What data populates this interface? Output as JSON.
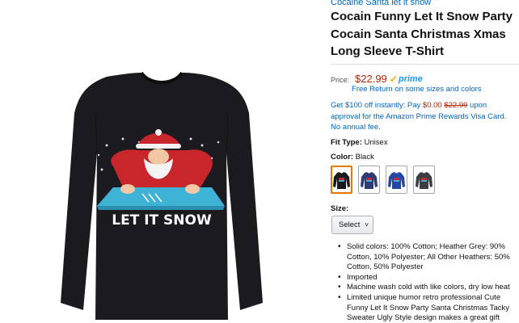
{
  "product": {
    "brand_link": "Cocaine Santa let it snow",
    "title": "Cocain Funny Let It Snow Party Cocain Santa Christmas Xmas Long Sleeve T-Shirt",
    "image_caption": "LET IT SNOW"
  },
  "pricing": {
    "label": "Price:",
    "price": "$22.99",
    "prime_label": "prime",
    "free_return": "Free Return on some sizes and colors",
    "promo_prefix": "Get $100 off instantly: Pay ",
    "promo_pay": "$0.00",
    "promo_strike": "$22.99",
    "promo_suffix": " upon approval for the Amazon Prime Rewards Visa Card. No annual fee."
  },
  "fit": {
    "label": "Fit Type:",
    "value": "Unisex"
  },
  "color": {
    "label": "Color:",
    "value": "Black",
    "swatches": [
      {
        "name": "Black",
        "hex": "#1a1a1e"
      },
      {
        "name": "Navy",
        "hex": "#2b3a78"
      },
      {
        "name": "Royal Blue",
        "hex": "#2347a8"
      },
      {
        "name": "Dark Heather",
        "hex": "#3c3d44"
      }
    ]
  },
  "size": {
    "label": "Size:",
    "select_label": "Select"
  },
  "bullets": [
    "Solid colors: 100% Cotton; Heather Grey: 90% Cotton, 10% Polyester; All Other Heathers: 50% Cotton, 50% Polyester",
    "Imported",
    "Machine wash cold with like colors, dry low heat",
    "Limited unique humor retro professional Cute Funny Let It Snow Party Santa Christmas Tacky Sweater Ugly Style design makes a great gift"
  ]
}
